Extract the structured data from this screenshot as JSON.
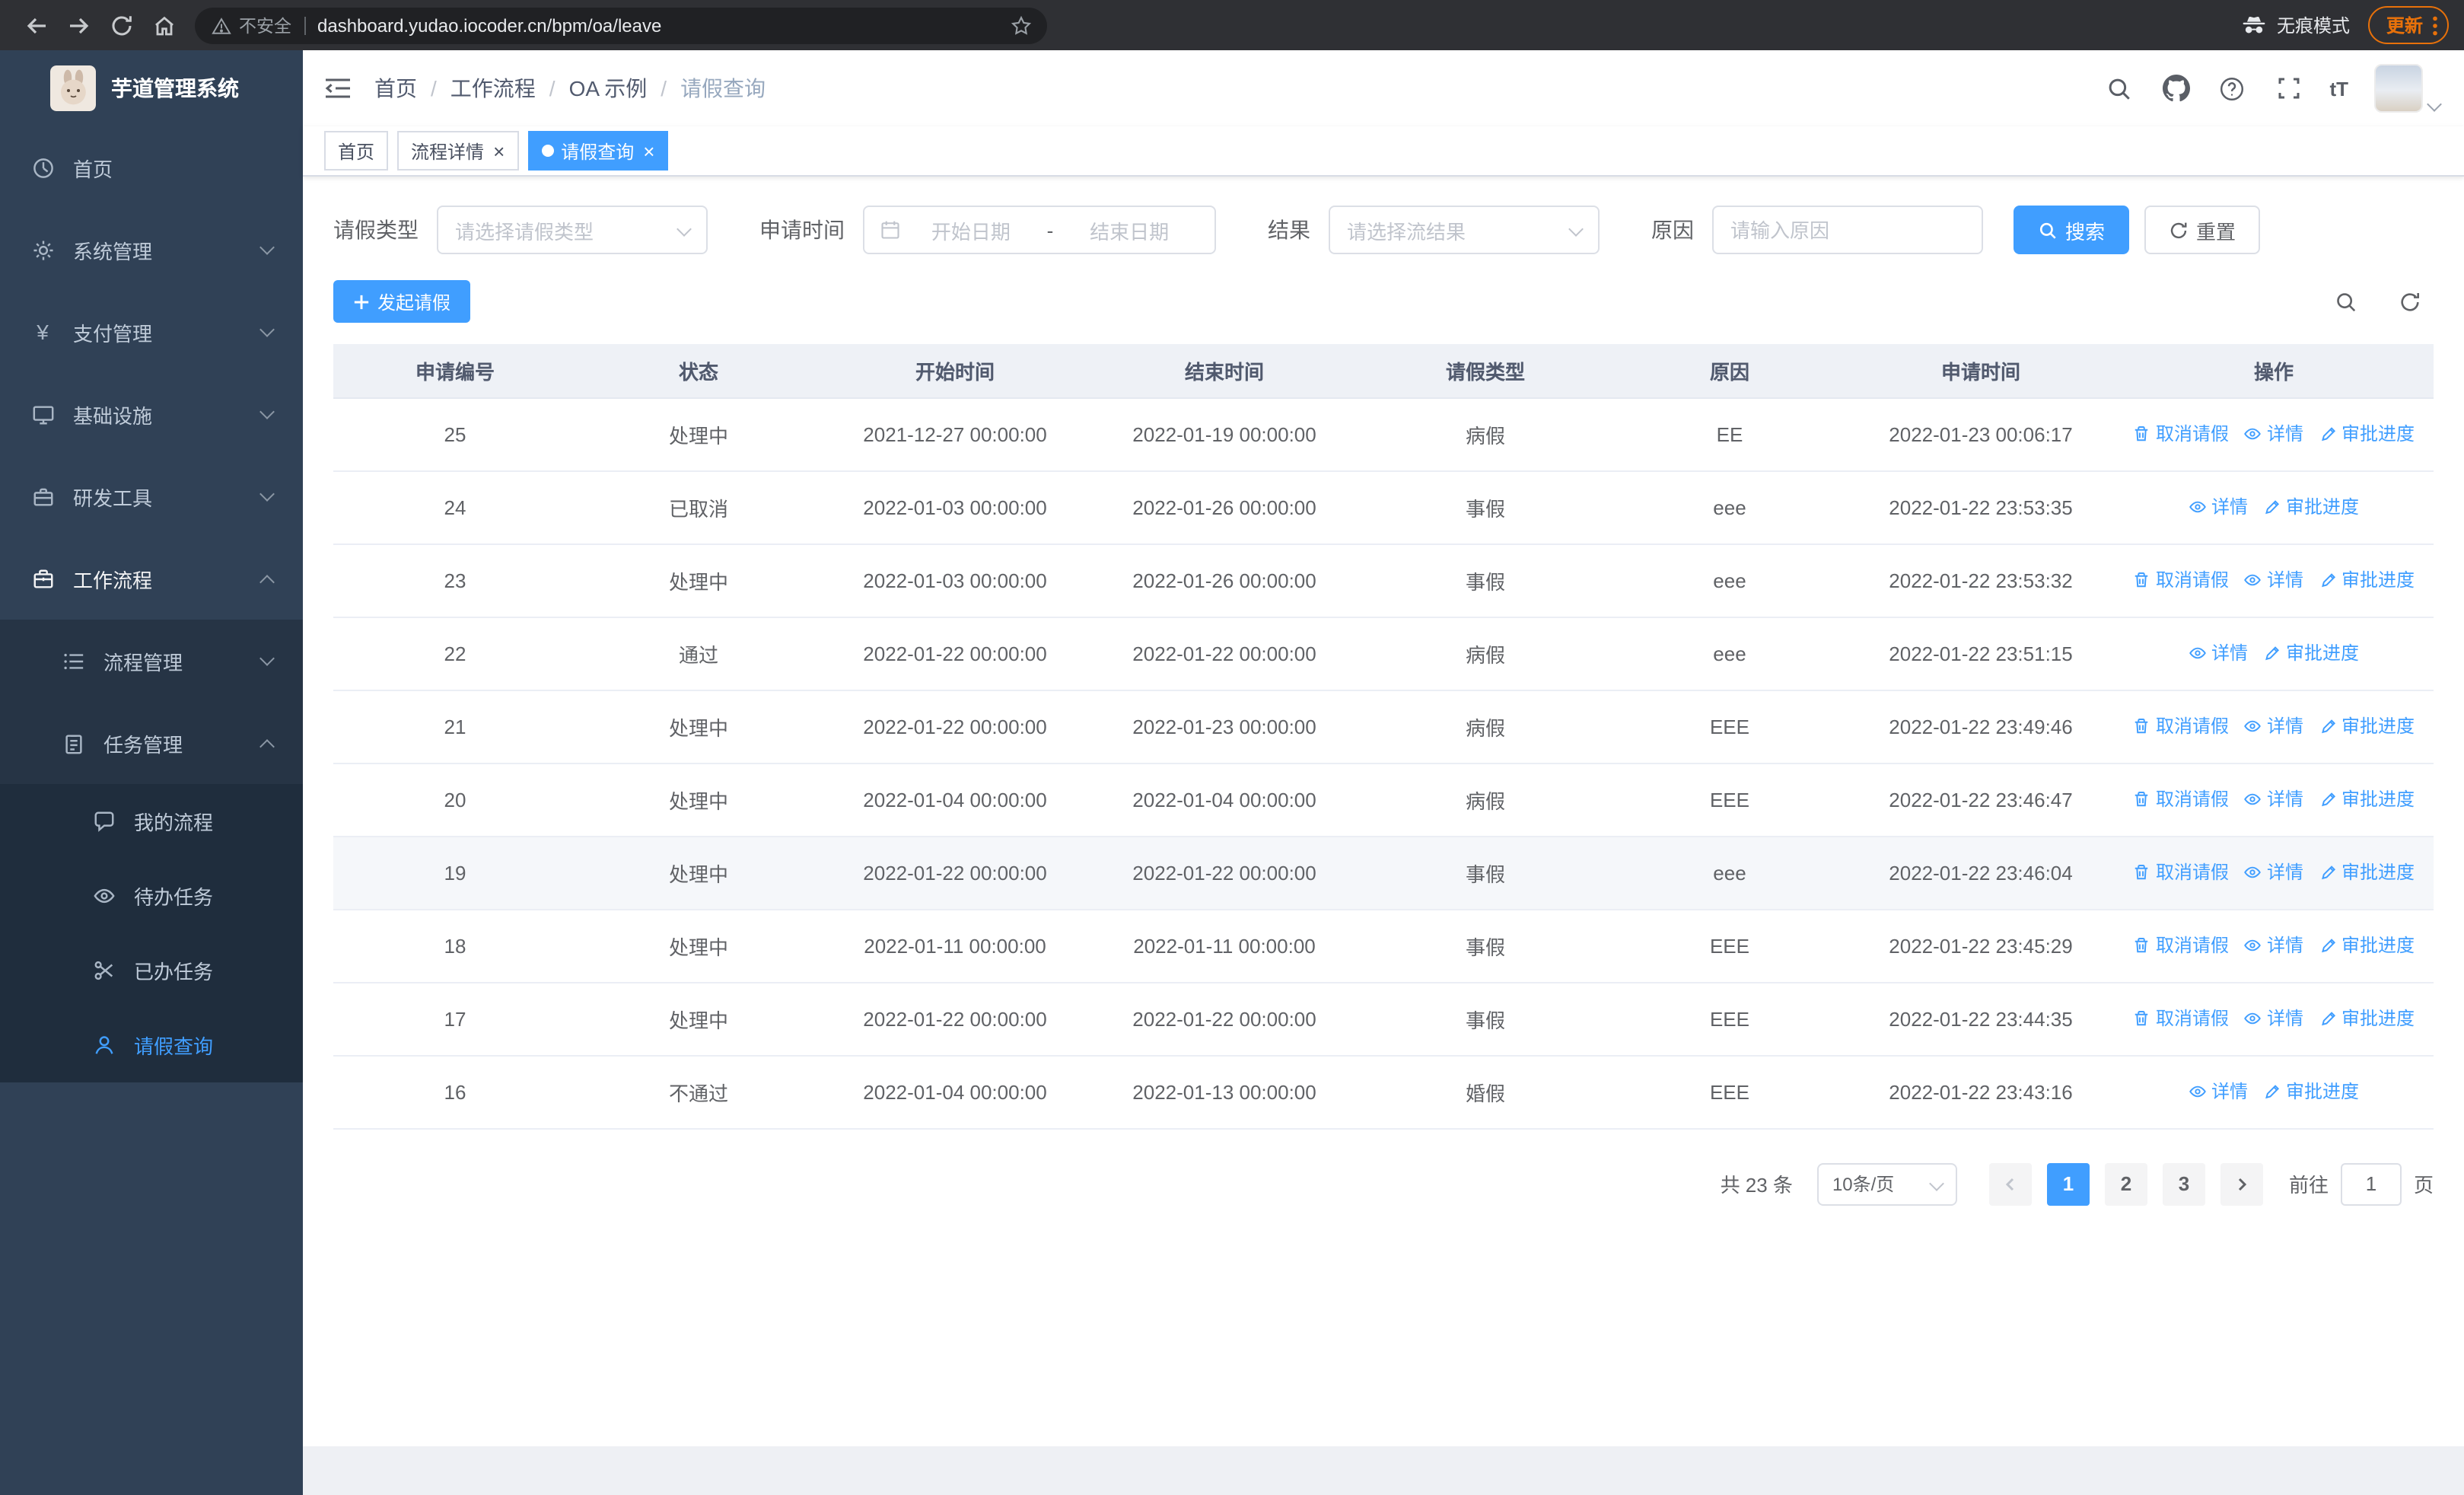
{
  "browser": {
    "security_label": "不安全",
    "url": "dashboard.yudao.iocoder.cn/bpm/oa/leave",
    "incognito_label": "无痕模式",
    "update_label": "更新"
  },
  "sidebar": {
    "title": "芋道管理系统",
    "items": [
      {
        "label": "首页",
        "icon": "home-icon"
      },
      {
        "label": "系统管理",
        "icon": "gear-icon"
      },
      {
        "label": "支付管理",
        "icon": "yen-icon"
      },
      {
        "label": "基础设施",
        "icon": "monitor-icon"
      },
      {
        "label": "研发工具",
        "icon": "toolbox-icon"
      },
      {
        "label": "工作流程",
        "icon": "briefcase-icon"
      }
    ],
    "process_group": [
      {
        "label": "流程管理",
        "icon": "list-icon"
      },
      {
        "label": "任务管理",
        "icon": "clipboard-icon"
      }
    ],
    "task_children": [
      {
        "label": "我的流程",
        "icon": "chat-icon"
      },
      {
        "label": "待办任务",
        "icon": "eye-icon"
      },
      {
        "label": "已办任务",
        "icon": "scissors-icon"
      },
      {
        "label": "请假查询",
        "icon": "user-icon"
      }
    ]
  },
  "navbar": {
    "breadcrumb": [
      "首页",
      "工作流程",
      "OA 示例",
      "请假查询"
    ],
    "font_icon_label": "tT"
  },
  "tabs": [
    {
      "label": "首页"
    },
    {
      "label": "流程详情"
    },
    {
      "label": "请假查询"
    }
  ],
  "filters": {
    "leave_type_label": "请假类型",
    "leave_type_placeholder": "请选择请假类型",
    "apply_time_label": "申请时间",
    "start_placeholder": "开始日期",
    "range_separator": "-",
    "end_placeholder": "结束日期",
    "result_label": "结果",
    "result_placeholder": "请选择流结果",
    "reason_label": "原因",
    "reason_placeholder": "请输入原因",
    "search_label": "搜索",
    "reset_label": "重置"
  },
  "toolbar": {
    "create_label": "发起请假"
  },
  "table": {
    "columns": [
      "申请编号",
      "状态",
      "开始时间",
      "结束时间",
      "请假类型",
      "原因",
      "申请时间",
      "操作"
    ],
    "action_labels": {
      "cancel": "取消请假",
      "detail": "详情",
      "progress": "审批进度"
    },
    "rows": [
      {
        "id": "25",
        "status": "处理中",
        "start": "2021-12-27 00:00:00",
        "end": "2022-01-19 00:00:00",
        "type": "病假",
        "reason": "EE",
        "applied": "2022-01-23 00:06:17",
        "actions": [
          "cancel",
          "detail",
          "progress"
        ],
        "highlight": false
      },
      {
        "id": "24",
        "status": "已取消",
        "start": "2022-01-03 00:00:00",
        "end": "2022-01-26 00:00:00",
        "type": "事假",
        "reason": "eee",
        "applied": "2022-01-22 23:53:35",
        "actions": [
          "detail",
          "progress"
        ],
        "highlight": false
      },
      {
        "id": "23",
        "status": "处理中",
        "start": "2022-01-03 00:00:00",
        "end": "2022-01-26 00:00:00",
        "type": "事假",
        "reason": "eee",
        "applied": "2022-01-22 23:53:32",
        "actions": [
          "cancel",
          "detail",
          "progress"
        ],
        "highlight": false
      },
      {
        "id": "22",
        "status": "通过",
        "start": "2022-01-22 00:00:00",
        "end": "2022-01-22 00:00:00",
        "type": "病假",
        "reason": "eee",
        "applied": "2022-01-22 23:51:15",
        "actions": [
          "detail",
          "progress"
        ],
        "highlight": false
      },
      {
        "id": "21",
        "status": "处理中",
        "start": "2022-01-22 00:00:00",
        "end": "2022-01-23 00:00:00",
        "type": "病假",
        "reason": "EEE",
        "applied": "2022-01-22 23:49:46",
        "actions": [
          "cancel",
          "detail",
          "progress"
        ],
        "highlight": false
      },
      {
        "id": "20",
        "status": "处理中",
        "start": "2022-01-04 00:00:00",
        "end": "2022-01-04 00:00:00",
        "type": "病假",
        "reason": "EEE",
        "applied": "2022-01-22 23:46:47",
        "actions": [
          "cancel",
          "detail",
          "progress"
        ],
        "highlight": false
      },
      {
        "id": "19",
        "status": "处理中",
        "start": "2022-01-22 00:00:00",
        "end": "2022-01-22 00:00:00",
        "type": "事假",
        "reason": "eee",
        "applied": "2022-01-22 23:46:04",
        "actions": [
          "cancel",
          "detail",
          "progress"
        ],
        "highlight": true
      },
      {
        "id": "18",
        "status": "处理中",
        "start": "2022-01-11 00:00:00",
        "end": "2022-01-11 00:00:00",
        "type": "事假",
        "reason": "EEE",
        "applied": "2022-01-22 23:45:29",
        "actions": [
          "cancel",
          "detail",
          "progress"
        ],
        "highlight": false
      },
      {
        "id": "17",
        "status": "处理中",
        "start": "2022-01-22 00:00:00",
        "end": "2022-01-22 00:00:00",
        "type": "事假",
        "reason": "EEE",
        "applied": "2022-01-22 23:44:35",
        "actions": [
          "cancel",
          "detail",
          "progress"
        ],
        "highlight": false
      },
      {
        "id": "16",
        "status": "不通过",
        "start": "2022-01-04 00:00:00",
        "end": "2022-01-13 00:00:00",
        "type": "婚假",
        "reason": "EEE",
        "applied": "2022-01-22 23:43:16",
        "actions": [
          "detail",
          "progress"
        ],
        "highlight": false
      }
    ]
  },
  "pagination": {
    "total_label": "共 23 条",
    "page_size_label": "10条/页",
    "pages": [
      "1",
      "2",
      "3"
    ],
    "active_page": "1",
    "goto_label": "前往",
    "goto_value": "1",
    "page_unit_label": "页"
  },
  "colors": {
    "accent": "#409eff",
    "update_orange": "#e8710a",
    "sidebar_bg": "#304156"
  }
}
